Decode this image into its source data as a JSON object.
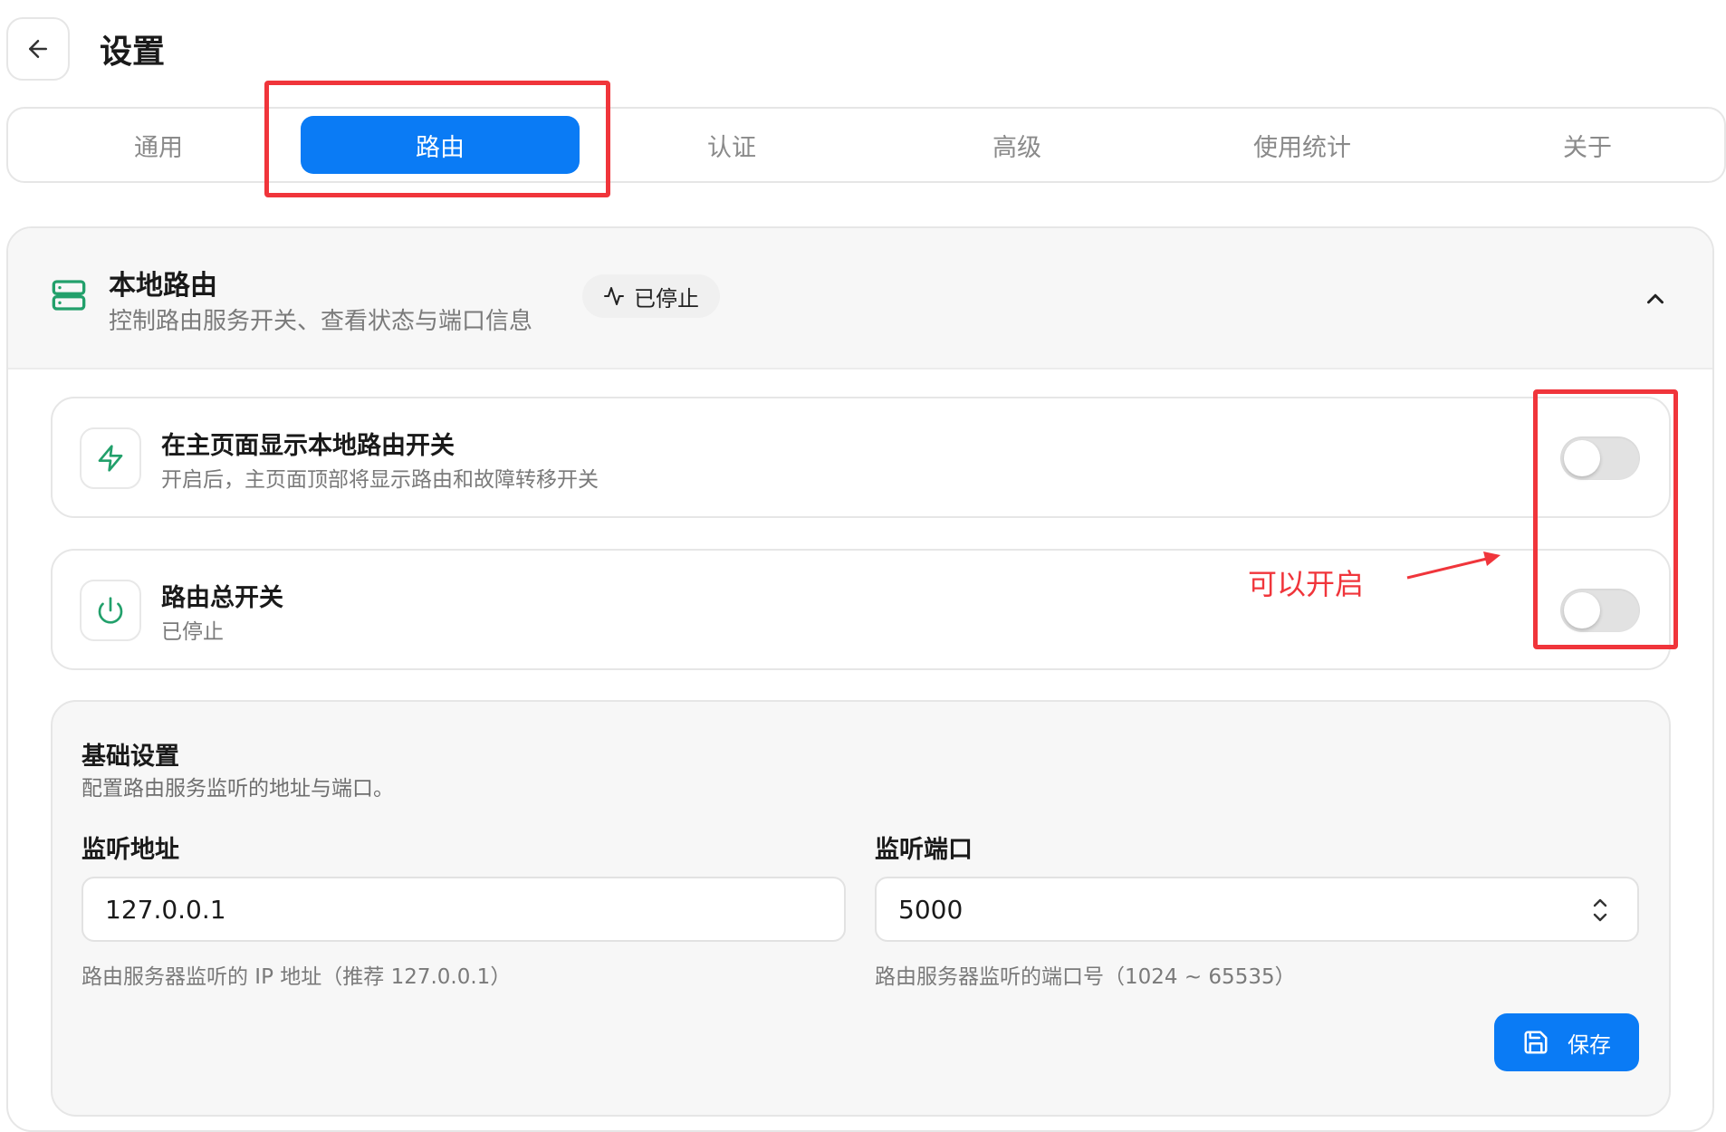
{
  "header": {
    "title": "设置",
    "back_icon": "arrow-left-icon"
  },
  "tabs": [
    {
      "label": "通用",
      "active": false
    },
    {
      "label": "路由",
      "active": true
    },
    {
      "label": "认证",
      "active": false
    },
    {
      "label": "高级",
      "active": false
    },
    {
      "label": "使用统计",
      "active": false
    },
    {
      "label": "关于",
      "active": false
    }
  ],
  "section": {
    "icon": "server-icon",
    "title": "本地路由",
    "subtitle": "控制路由服务开关、查看状态与端口信息",
    "status_icon": "activity-icon",
    "status": "已停止",
    "collapse_icon": "chevron-up-icon"
  },
  "cards": [
    {
      "icon": "zap-icon",
      "title": "在主页面显示本地路由开关",
      "subtitle": "开启后，主页面顶部将显示路由和故障转移开关",
      "toggle_on": false
    },
    {
      "icon": "power-icon",
      "title": "路由总开关",
      "subtitle": "已停止",
      "toggle_on": false
    }
  ],
  "annotation": {
    "text": "可以开启",
    "color": "#f0353b"
  },
  "basic": {
    "title": "基础设置",
    "desc": "配置路由服务监听的地址与端口。",
    "address_label": "监听地址",
    "address_value": "127.0.0.1",
    "address_hint": "路由服务器监听的 IP 地址（推荐 127.0.0.1）",
    "port_label": "监听端口",
    "port_value": "5000",
    "port_hint": "路由服务器监听的端口号（1024 ~ 65535）",
    "save_label": "保存",
    "save_icon": "save-icon"
  },
  "colors": {
    "accent": "#0a7bf5",
    "green": "#22a06b",
    "annotation": "#f0353b"
  }
}
